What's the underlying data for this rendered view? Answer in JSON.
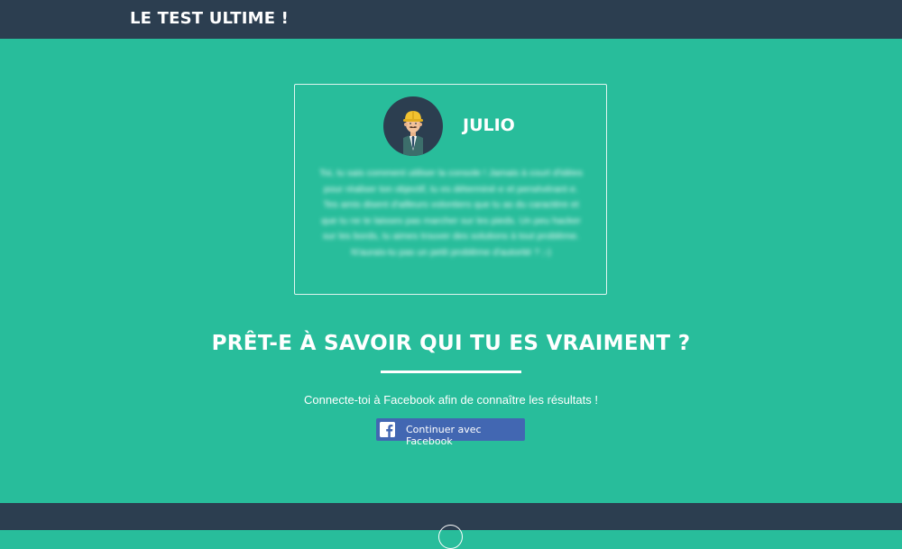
{
  "header": {
    "title": "LE TEST ULTIME !"
  },
  "result": {
    "avatar_icon": "character-avatar-icon",
    "name": "JULIO",
    "description": "Toi, tu sais comment utiliser la console ! Jamais à court d'idées pour réaliser ton objectif, tu es déterminé·e et persévérant·e. Tes amis disent d'ailleurs volontiers que tu as du caractère et que tu ne te laisses pas marcher sur les pieds. Un peu hacker sur les bords, tu aimes trouver des solutions à tout problème. N'aurais-tu pas un petit problème d'autorité ? ;-)"
  },
  "cta": {
    "headline": "PRÊT-E À SAVOIR QUI TU ES VRAIMENT ?",
    "subtext": "Connecte-toi à Facebook afin de connaître les résultats !",
    "facebook_button_label": "Continuer avec Facebook",
    "facebook_icon": "facebook-icon"
  },
  "footer": {
    "logo_icon": "footer-logo-icon"
  },
  "colors": {
    "background": "#28bd9b",
    "header_bg": "#2c3e50",
    "facebook_blue": "#4267b2",
    "text": "#ffffff"
  }
}
